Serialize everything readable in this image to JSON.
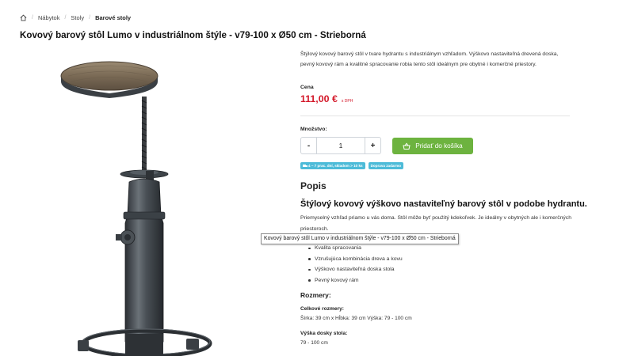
{
  "breadcrumb": {
    "home_icon": "home-icon",
    "items": [
      "Nábytok",
      "Stoly"
    ],
    "current": "Barové stoly"
  },
  "product": {
    "title": "Kovový barový stôl Lumo v industriálnom štýle - v79-100 x Ø50 cm - Strieborná",
    "short_description": "Štýlový kovový barový stôl v tvare hydrantu s industriálnym vzhľadom. Výškovo nastaviteľná drevená doska, pevný kovový rám a kvalitné spracovanie robia tento stôl ideálnym pre obytné i komerčné priestory.",
    "price_label": "Cena",
    "price": "111,00 €",
    "vat_note": "s DPH",
    "quantity_label": "Množstvo:",
    "quantity_value": "1",
    "minus": "-",
    "plus": "+",
    "add_to_cart": "Pridať do košíka",
    "badges": {
      "delivery": "4 – 7 prac. dní, skladom > 10 ks",
      "shipping": "Doprava zadarmo"
    }
  },
  "description": {
    "heading": "Popis",
    "subheading": "Štýlový kovový výškovo nastaviteľný barový stôl v podobe hydrantu.",
    "paragraph": "Priemyselný vzhľad priamo u vás doma. Stôl môže byť použitý kdekoľvek. Je ideálny v obytných ale i komerčných priestoroch.",
    "features": [
      "Kvalita spracovania",
      "Vzrušujúca kombinácia dreva a kovu",
      "Výškovo nastaviteľná doska stola",
      "Pevný kovový rám"
    ],
    "dimensions_heading": "Rozmery:",
    "total_dims_label": "Celkové rozmery:",
    "total_dims_value": "Šírka: 39 cm x Hĺbka: 39 cm Výška: 79 - 100 cm",
    "top_height_label": "Výška dosky stola:",
    "top_height_value": "79 - 100 cm"
  },
  "tooltip": "Kovový barový stôl Lumo v industriálnom štýle - v79-100 x Ø50 cm - Strieborná",
  "colors": {
    "price_red": "#d4192a",
    "cart_green": "#6db33f",
    "badge_blue": "#4dbbd8"
  }
}
